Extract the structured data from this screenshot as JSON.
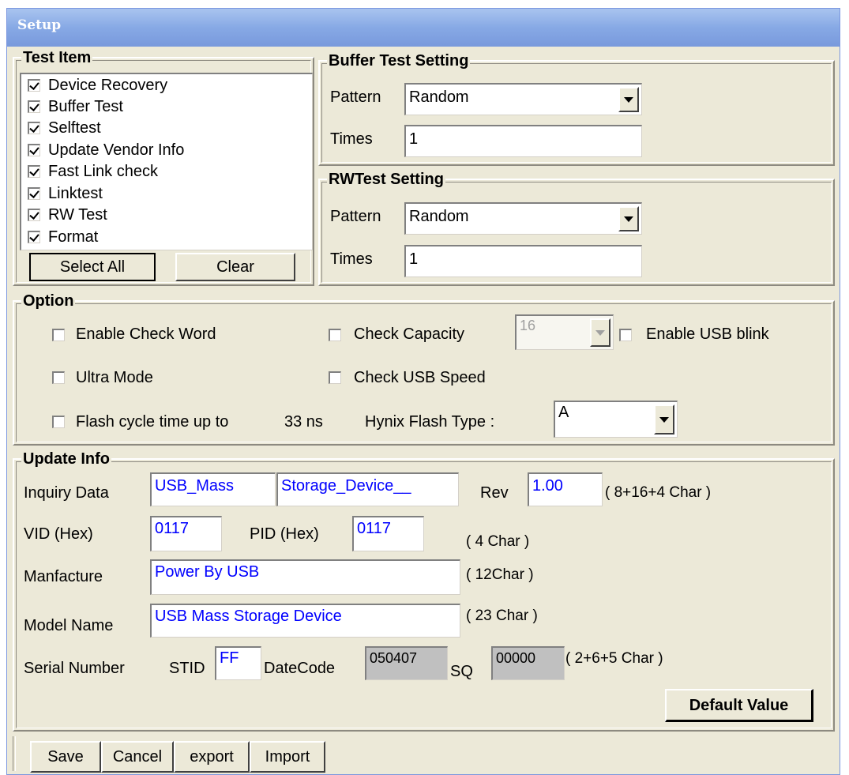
{
  "window": {
    "title": "Setup"
  },
  "test_item": {
    "legend": "Test Item",
    "items": [
      {
        "label": "Device Recovery",
        "checked": true
      },
      {
        "label": "Buffer Test",
        "checked": true
      },
      {
        "label": "Selftest",
        "checked": true
      },
      {
        "label": "Update Vendor Info",
        "checked": true
      },
      {
        "label": "Fast Link check",
        "checked": true
      },
      {
        "label": "Linktest",
        "checked": true
      },
      {
        "label": "RW Test",
        "checked": true
      },
      {
        "label": "Format",
        "checked": true
      }
    ],
    "select_all": "Select All",
    "clear": "Clear"
  },
  "buffer_test": {
    "legend": "Buffer Test Setting",
    "pattern_label": "Pattern",
    "pattern_value": "Random",
    "times_label": "Times",
    "times_value": "1"
  },
  "rw_test": {
    "legend": "RWTest Setting",
    "pattern_label": "Pattern",
    "pattern_value": "Random",
    "times_label": "Times",
    "times_value": "1"
  },
  "option": {
    "legend": "Option",
    "enable_check_word": "Enable Check Word",
    "check_capacity": "Check Capacity",
    "capacity_value": "16",
    "enable_usb_blink": "Enable USB blink",
    "ultra_mode": "Ultra Mode",
    "check_usb_speed": "Check USB Speed",
    "flash_cycle": "Flash cycle time up to",
    "flash_cycle_value": "33 ns",
    "hynix_label": "Hynix Flash Type :",
    "hynix_value": "A"
  },
  "update_info": {
    "legend": "Update Info",
    "inquiry_label": "Inquiry Data",
    "inquiry_vendor": "USB_Mass",
    "inquiry_product": "Storage_Device__",
    "rev_label": "Rev",
    "rev_value": "1.00",
    "inquiry_hint": "( 8+16+4 Char )",
    "vid_label": "VID (Hex)",
    "vid_value": "0117",
    "pid_label": "PID (Hex)",
    "pid_value": "0117",
    "vidpid_hint": "( 4 Char )",
    "manufacture_label": "Manfacture",
    "manufacture_value": "Power By USB",
    "manufacture_hint": "( 12Char )",
    "model_label": "Model Name",
    "model_value": "USB Mass Storage Device",
    "model_hint": "( 23 Char )",
    "serial_label": "Serial Number",
    "stid_label": "STID",
    "stid_value": "FF",
    "datecode_label": "DateCode",
    "datecode_value": "050407",
    "sq_label": "SQ",
    "sq_value": "00000",
    "serial_hint": "( 2+6+5 Char )",
    "default_value": "Default Value"
  },
  "toolbar": {
    "save": "Save",
    "cancel": "Cancel",
    "export": "export",
    "import": "Import"
  }
}
